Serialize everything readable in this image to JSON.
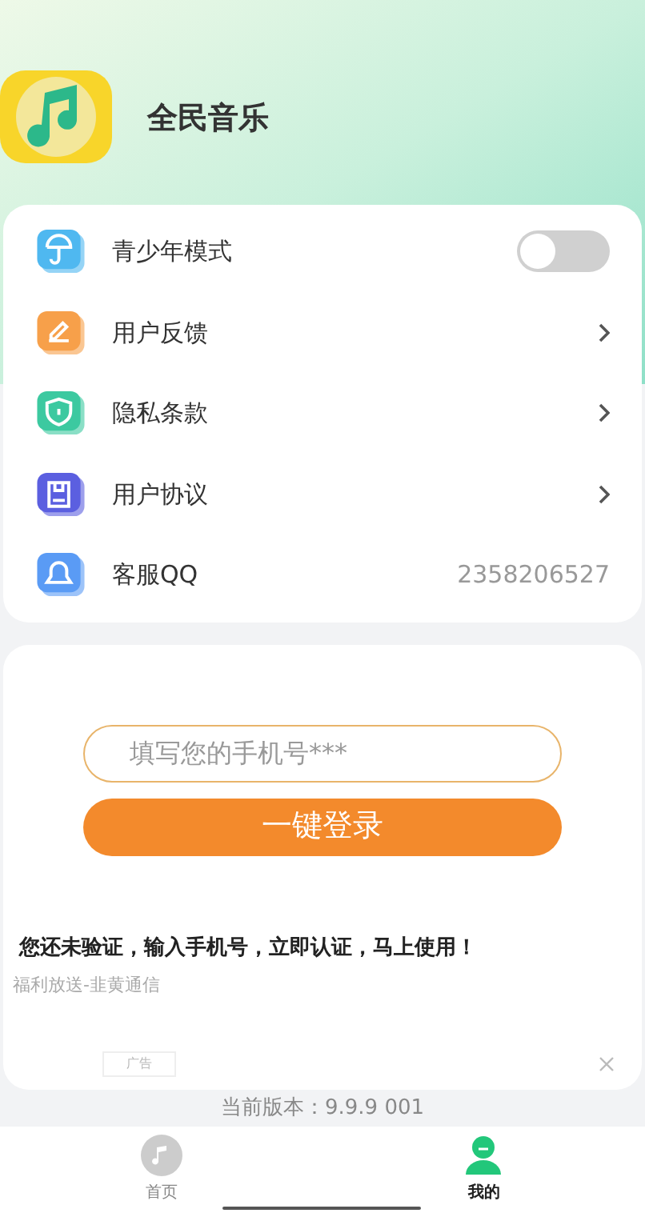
{
  "app": {
    "name": "全民音乐"
  },
  "menu": [
    {
      "kind": "toggle",
      "label": "青少年模式",
      "on": false,
      "color": "#4fb8f0"
    },
    {
      "kind": "link",
      "label": "用户反馈",
      "color": "#f7a04a"
    },
    {
      "kind": "link",
      "label": "隐私条款",
      "color": "#3cc9a0"
    },
    {
      "kind": "link",
      "label": "用户协议",
      "color": "#5b5fe0"
    },
    {
      "kind": "value",
      "label": "客服QQ",
      "value": "2358206527",
      "color": "#5a9bf5"
    }
  ],
  "login": {
    "placeholder": "填写您的手机号***",
    "button": "一键登录"
  },
  "ad": {
    "headline": "您还未验证，输入手机号，立即认证，马上使用！",
    "source": "福利放送-韭黄通信",
    "badge": "广告"
  },
  "version": "当前版本：9.9.9 001",
  "tabs": [
    {
      "label": "首页",
      "selected": false
    },
    {
      "label": "我的",
      "selected": true
    }
  ]
}
